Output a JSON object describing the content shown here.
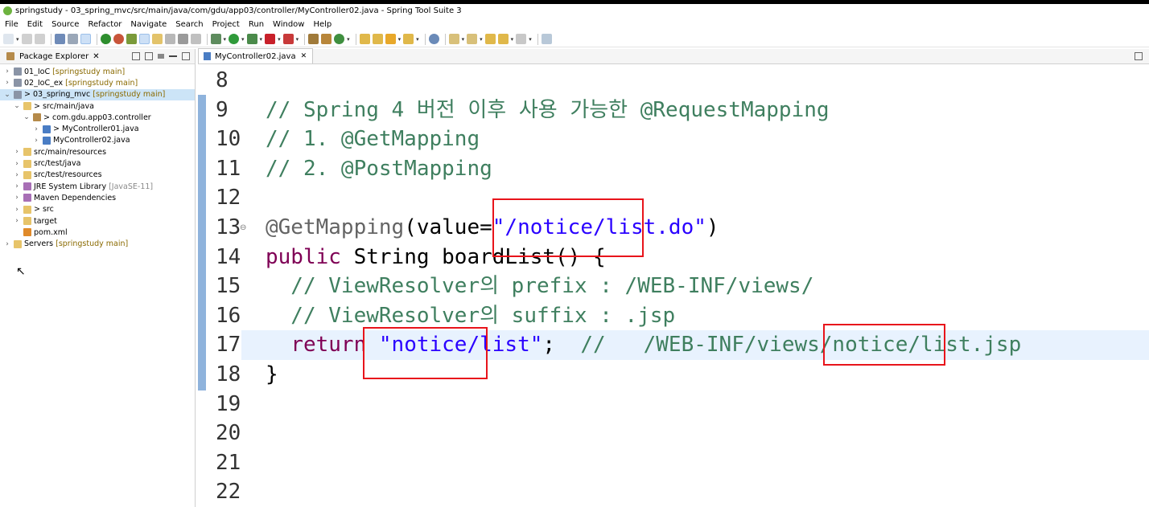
{
  "window": {
    "title": "springstudy - 03_spring_mvc/src/main/java/com/gdu/app03/controller/MyController02.java - Spring Tool Suite 3"
  },
  "menu": [
    "File",
    "Edit",
    "Source",
    "Refactor",
    "Navigate",
    "Search",
    "Project",
    "Run",
    "Window",
    "Help"
  ],
  "package_explorer": {
    "tab_label": "Package Explorer",
    "close": "✕",
    "items": [
      {
        "label": "01_IoC",
        "decor": "[springstudy main]",
        "indent": 0,
        "icon": "project-icon",
        "twisty": "›"
      },
      {
        "label": "02_IoC_ex",
        "decor": "[springstudy main]",
        "indent": 0,
        "icon": "project-icon",
        "twisty": "›"
      },
      {
        "label": "> 03_spring_mvc",
        "decor": "[springstudy main]",
        "indent": 0,
        "icon": "project-icon",
        "twisty": "⌄",
        "selected": true
      },
      {
        "label": "> src/main/java",
        "decor": "",
        "indent": 1,
        "icon": "source-folder-icon",
        "twisty": "⌄"
      },
      {
        "label": "> com.gdu.app03.controller",
        "decor": "",
        "indent": 2,
        "icon": "package-icon",
        "twisty": "⌄"
      },
      {
        "label": "> MyController01.java",
        "decor": "",
        "indent": 3,
        "icon": "java-file-icon",
        "twisty": "›"
      },
      {
        "label": "MyController02.java",
        "decor": "",
        "indent": 3,
        "icon": "java-file-icon",
        "twisty": "›"
      },
      {
        "label": "src/main/resources",
        "decor": "",
        "indent": 1,
        "icon": "source-folder-icon",
        "twisty": "›"
      },
      {
        "label": "src/test/java",
        "decor": "",
        "indent": 1,
        "icon": "source-folder-icon",
        "twisty": "›"
      },
      {
        "label": "src/test/resources",
        "decor": "",
        "indent": 1,
        "icon": "source-folder-icon",
        "twisty": "›"
      },
      {
        "label": "JRE System Library",
        "decor": "[JavaSE-11]",
        "indent": 1,
        "icon": "library-icon",
        "twisty": "›"
      },
      {
        "label": "Maven Dependencies",
        "decor": "",
        "indent": 1,
        "icon": "library-icon",
        "twisty": "›"
      },
      {
        "label": "> src",
        "decor": "",
        "indent": 1,
        "icon": "folder-icon",
        "twisty": "›"
      },
      {
        "label": "target",
        "decor": "",
        "indent": 1,
        "icon": "folder-icon",
        "twisty": "›"
      },
      {
        "label": "pom.xml",
        "decor": "",
        "indent": 1,
        "icon": "xml-file-icon",
        "twisty": ""
      },
      {
        "label": "Servers",
        "decor": "[springstudy main]",
        "indent": 0,
        "icon": "folder-icon",
        "twisty": "›"
      }
    ]
  },
  "editor": {
    "tab_label": "MyController02.java",
    "close": "✕",
    "lines": [
      {
        "num": "8",
        "segments": []
      },
      {
        "num": "9",
        "segments": [
          {
            "c": "comment",
            "t": "// Spring 4 버전 이후 사용 가능한 @RequestMapping"
          }
        ]
      },
      {
        "num": "10",
        "segments": [
          {
            "c": "comment",
            "t": "// 1. @GetMapping"
          }
        ]
      },
      {
        "num": "11",
        "segments": [
          {
            "c": "comment",
            "t": "// 2. @PostMapping"
          }
        ]
      },
      {
        "num": "12",
        "segments": []
      },
      {
        "num": "13",
        "fold": "⊖",
        "segments": [
          {
            "c": "annotation",
            "t": "@GetMapping"
          },
          {
            "c": "plain",
            "t": "(value="
          },
          {
            "c": "string",
            "t": "\"/notice/list.do\""
          },
          {
            "c": "plain",
            "t": ")"
          }
        ]
      },
      {
        "num": "14",
        "segments": [
          {
            "c": "keyword",
            "t": "public"
          },
          {
            "c": "plain",
            "t": " String boardList() {"
          }
        ]
      },
      {
        "num": "15",
        "segments": [
          {
            "c": "comment",
            "t": "  // ViewResolver의 prefix : /WEB-INF/views/"
          }
        ]
      },
      {
        "num": "16",
        "segments": [
          {
            "c": "comment",
            "t": "  // ViewResolver의 suffix : .jsp"
          }
        ]
      },
      {
        "num": "17",
        "current": true,
        "segments": [
          {
            "c": "plain",
            "t": "  "
          },
          {
            "c": "keyword",
            "t": "return"
          },
          {
            "c": "plain",
            "t": " "
          },
          {
            "c": "string",
            "t": "\"notice/list\""
          },
          {
            "c": "plain",
            "t": ";  "
          },
          {
            "c": "comment",
            "t": "//   /WEB-INF/views/notice/list.jsp"
          }
        ]
      },
      {
        "num": "18",
        "segments": [
          {
            "c": "plain",
            "t": "}"
          }
        ]
      },
      {
        "num": "19",
        "segments": []
      },
      {
        "num": "20",
        "segments": []
      },
      {
        "num": "21",
        "segments": []
      },
      {
        "num": "22",
        "segments": []
      }
    ]
  },
  "colors": {
    "highlight": "#e8141b",
    "comment": "#3f7f5f",
    "keyword": "#7f0055",
    "string": "#2a00ff"
  }
}
